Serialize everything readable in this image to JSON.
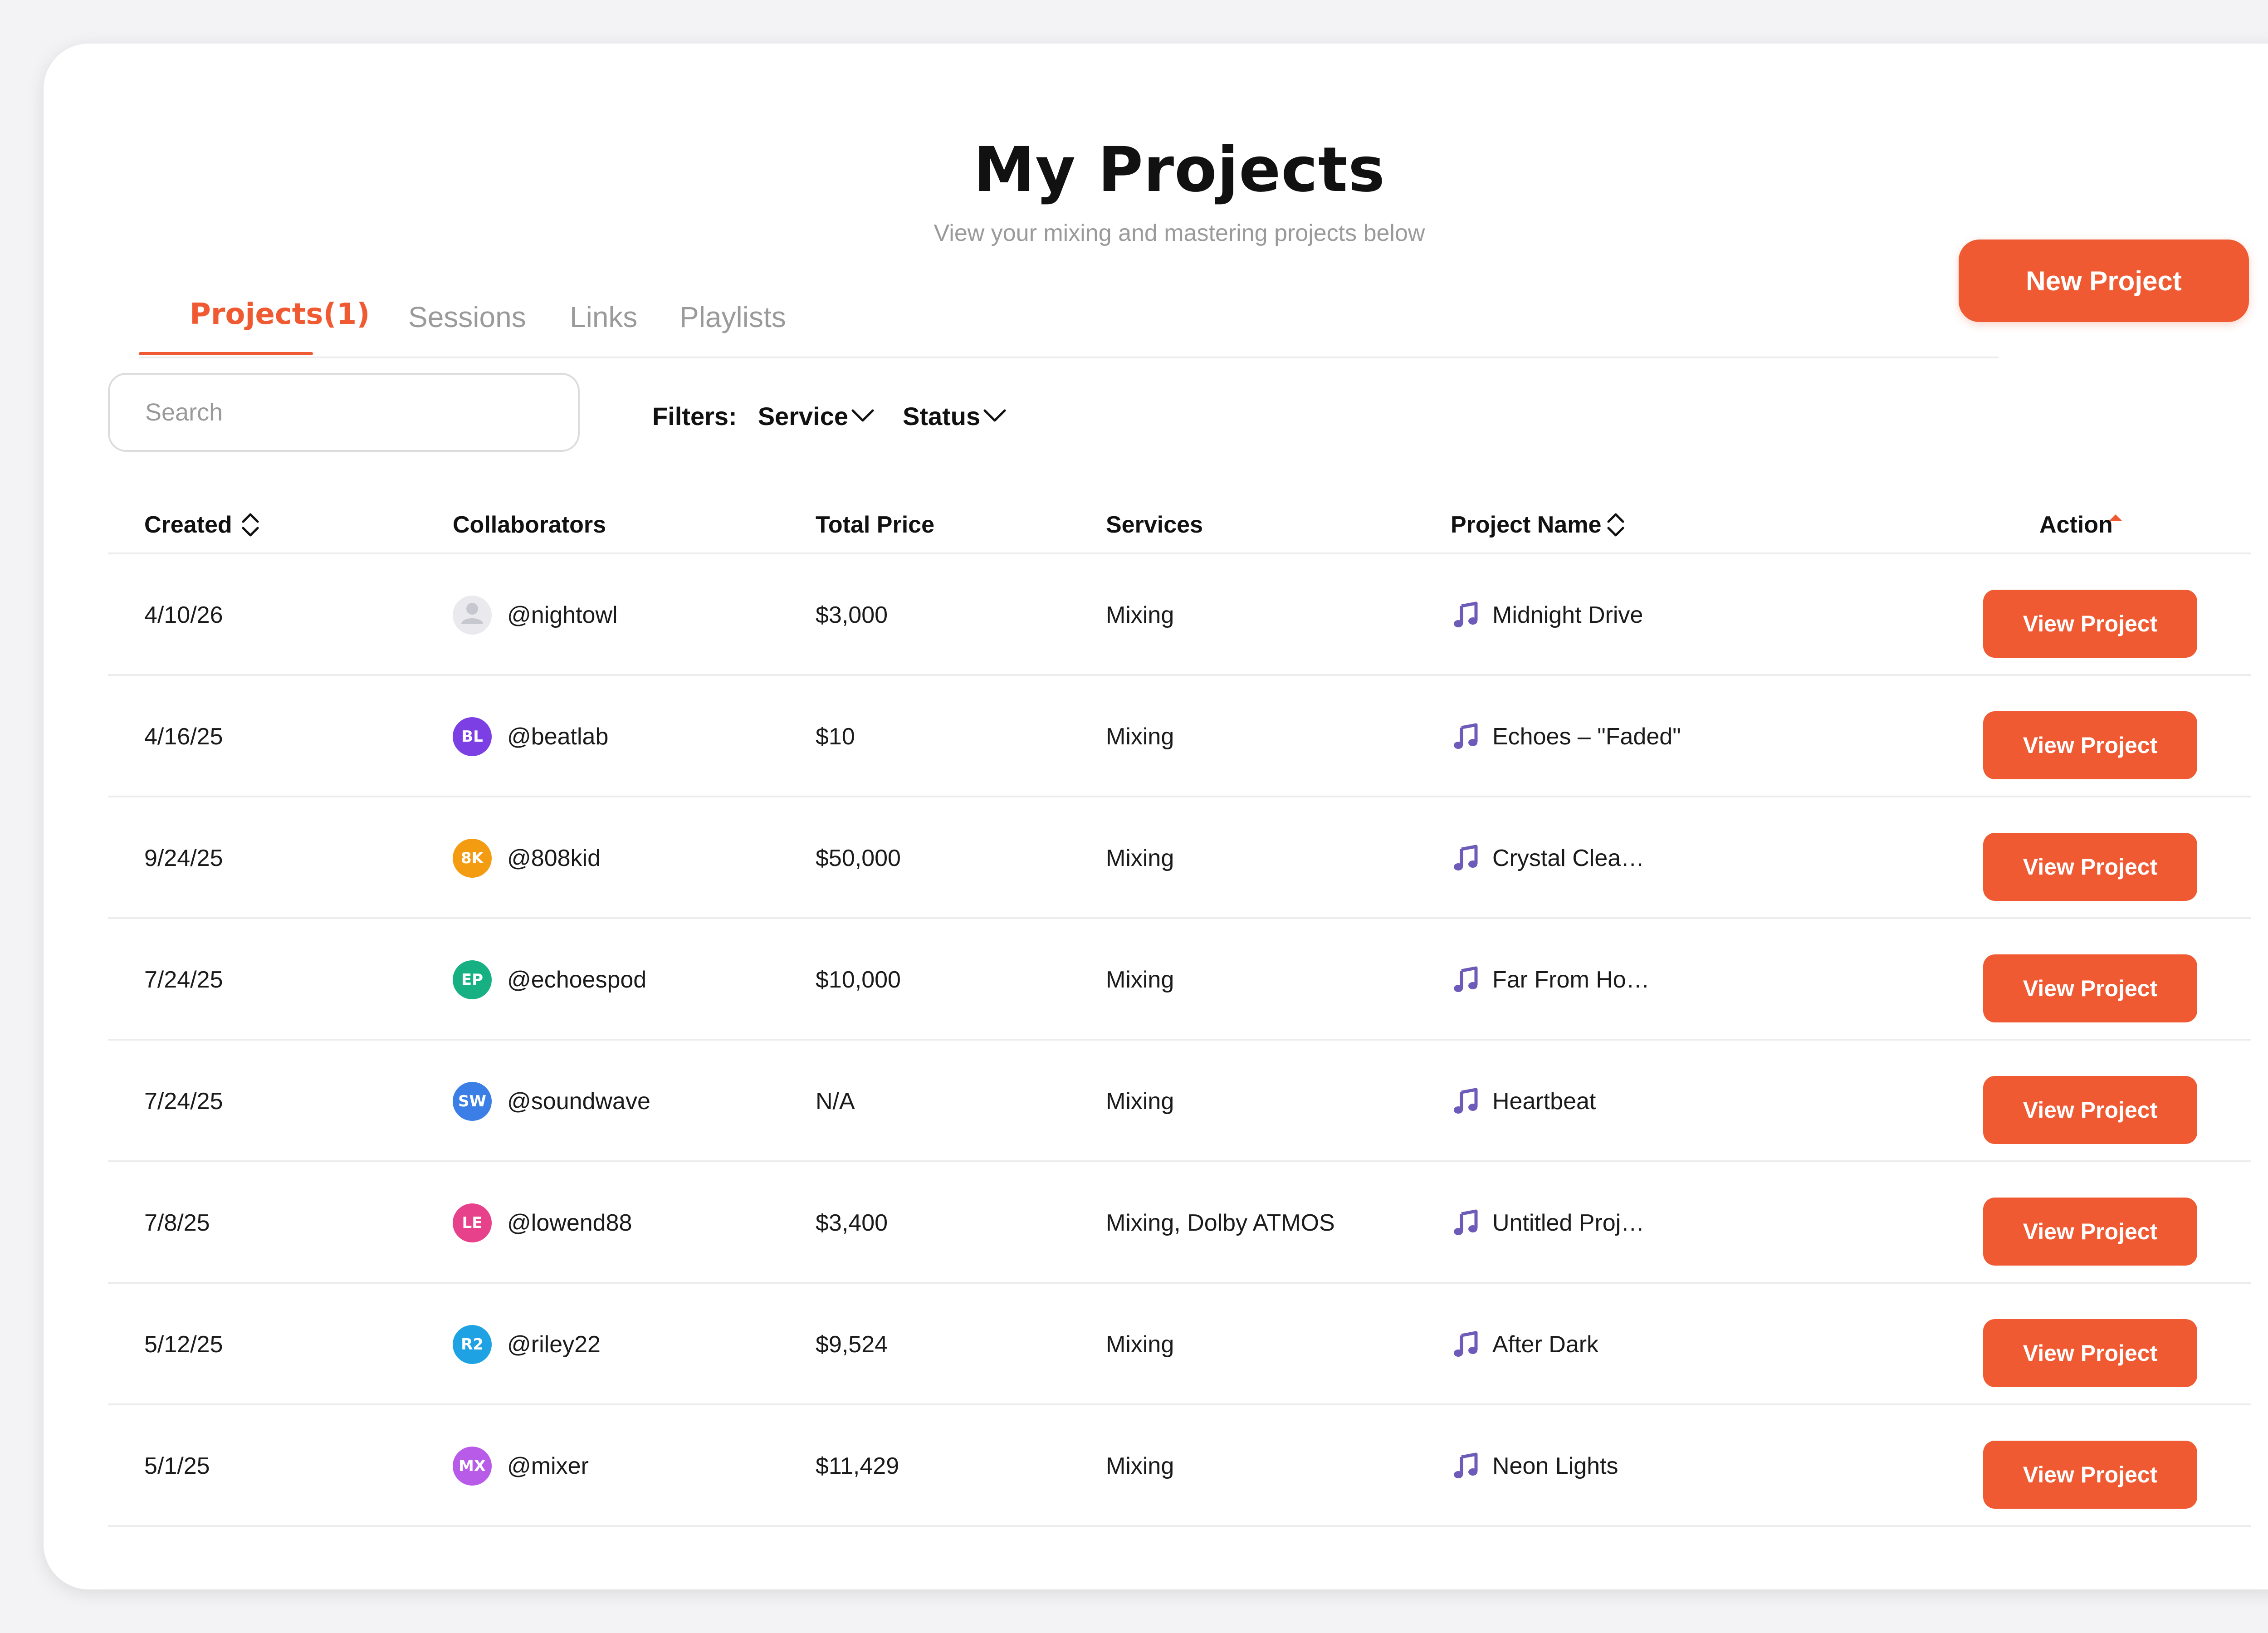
{
  "header": {
    "title": "My Projects",
    "subtitle": "View your mixing and mastering projects below"
  },
  "tabs": [
    {
      "label": "Projects(1)",
      "active": true
    },
    {
      "label": "Sessions",
      "active": false
    },
    {
      "label": "Links",
      "active": false
    },
    {
      "label": "Playlists",
      "active": false
    }
  ],
  "new_project_label": "New Project",
  "search": {
    "placeholder": "Search"
  },
  "filters": {
    "label": "Filters:",
    "service_label": "Service",
    "status_label": "Status"
  },
  "table": {
    "columns": {
      "created": "Created",
      "collaborators": "Collaborators",
      "total_price": "Total Price",
      "services": "Services",
      "project_name": "Project Name",
      "action": "Action"
    },
    "rows": [
      {
        "created": "4/10/26",
        "collaborator": "@nightowl",
        "initials": "",
        "avatar_color": "",
        "price": "$3,000",
        "services": "Mixing",
        "project": "Midnight Drive",
        "action": "View Project"
      },
      {
        "created": "4/16/25",
        "collaborator": "@beatlab",
        "initials": "BL",
        "avatar_color": "#7b3fe4",
        "price": "$10",
        "services": "Mixing",
        "project": "Echoes – \"Faded\"",
        "action": "View Project"
      },
      {
        "created": "9/24/25",
        "collaborator": "@808kid",
        "initials": "8K",
        "avatar_color": "#f39c12",
        "price": "$50,000",
        "services": "Mixing",
        "project": "Crystal Clea…",
        "action": "View Project"
      },
      {
        "created": "7/24/25",
        "collaborator": "@echoespod",
        "initials": "EP",
        "avatar_color": "#16b083",
        "price": "$10,000",
        "services": "Mixing",
        "project": "Far From Ho…",
        "action": "View Project"
      },
      {
        "created": "7/24/25",
        "collaborator": "@soundwave",
        "initials": "SW",
        "avatar_color": "#3b7fe6",
        "price": "N/A",
        "services": "Mixing",
        "project": "Heartbeat",
        "action": "View Project"
      },
      {
        "created": "7/8/25",
        "collaborator": "@lowend88",
        "initials": "LE",
        "avatar_color": "#e6418a",
        "price": "$3,400",
        "services": "Mixing, Dolby ATMOS",
        "project": "Untitled Proj…",
        "action": "View Project"
      },
      {
        "created": "5/12/25",
        "collaborator": "@riley22",
        "initials": "R2",
        "avatar_color": "#1ea2e3",
        "price": "$9,524",
        "services": "Mixing",
        "project": "After Dark",
        "action": "View Project"
      },
      {
        "created": "5/1/25",
        "collaborator": "@mixer",
        "initials": "MX",
        "avatar_color": "#b85be8",
        "price": "$11,429",
        "services": "Mixing",
        "project": "Neon Lights",
        "action": "View Project"
      }
    ]
  },
  "icons": {
    "sort": "sort-updown-icon",
    "sort_active": "sort-asc-icon",
    "chevron": "chevron-down-icon",
    "music": "music-note-icon",
    "user_placeholder": "user-placeholder-icon"
  },
  "colors": {
    "accent": "#f05a32",
    "music_icon": "#6e5ab8"
  }
}
